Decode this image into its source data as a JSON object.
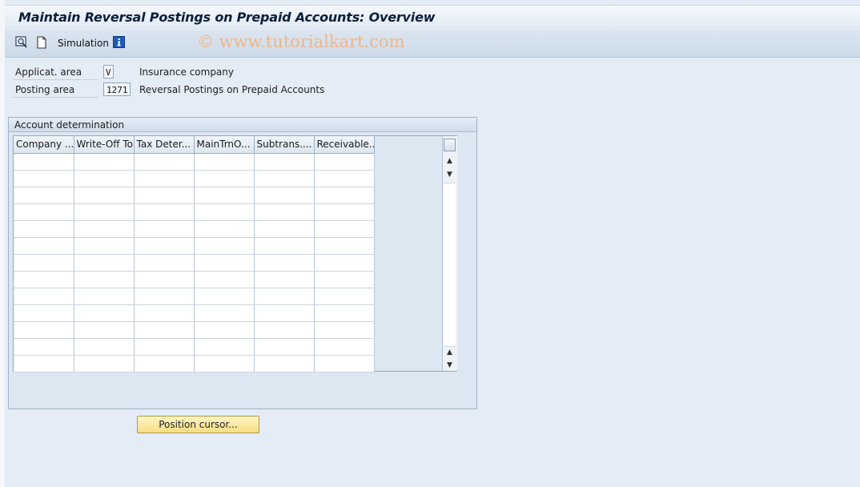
{
  "window": {
    "title": "Maintain Reversal Postings on Prepaid Accounts: Overview"
  },
  "toolbar": {
    "simulation_label": "Simulation",
    "icons": [
      "display-icon",
      "new-document-icon",
      "info-icon"
    ]
  },
  "watermark": "© www.tutorialkart.com",
  "fields": {
    "applicat_area": {
      "label": "Applicat. area",
      "value": "V",
      "description": "Insurance company"
    },
    "posting_area": {
      "label": "Posting area",
      "value": "1271",
      "description": "Reversal Postings on Prepaid Accounts"
    }
  },
  "group": {
    "title": "Account determination",
    "columns": [
      "Company ...",
      "Write-Off To",
      "Tax Deter...",
      "MainTrnO...",
      "Subtrans....",
      "Receivable..."
    ],
    "row_count": 13
  },
  "buttons": {
    "position_cursor": "Position cursor..."
  },
  "colors": {
    "background": "#e4ecf5",
    "button_yellow": "#f6dd83",
    "watermark": "#f0b484"
  }
}
